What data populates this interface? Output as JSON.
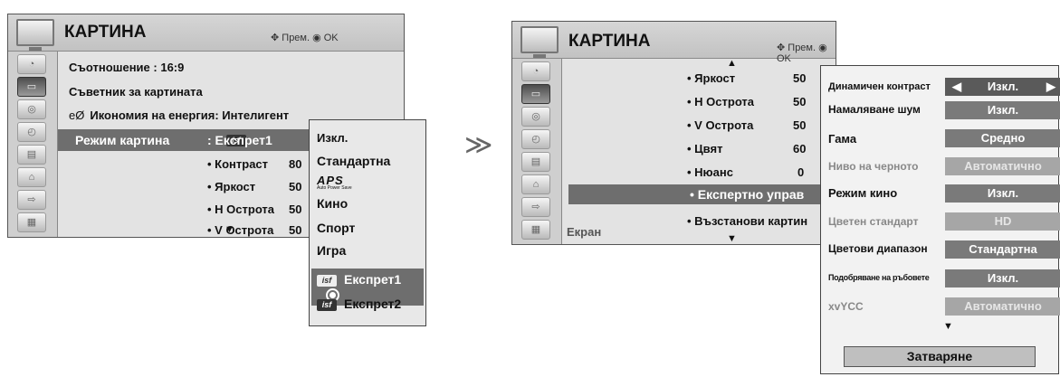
{
  "left_menu": {
    "title": "КАРТИНА",
    "hint": "Прем.  ◉  OK",
    "rows": [
      "Съотношение      : 16:9",
      "Съветник за картината",
      "Икономия на енергия: Интелигент"
    ],
    "eco_prefix": "eØ",
    "selected_row": {
      "label": "Режим картина",
      "value": ":   Експрет1"
    },
    "params": [
      {
        "label": "• Контраст",
        "value": "80"
      },
      {
        "label": "• Яркост",
        "value": "50"
      },
      {
        "label": "• Н Острота",
        "value": "50"
      },
      {
        "label": "• V Острота",
        "value": "50"
      }
    ]
  },
  "mode_dropdown": {
    "items": [
      "Изкл.",
      "Стандартна",
      "APS",
      "Кино",
      "Спорт",
      "Игра",
      "Експрет1",
      "Експрет2"
    ],
    "selected": "Експрет1",
    "isf_badge": "isf",
    "aps_subtext": "Auto Power Save"
  },
  "right_menu": {
    "title": "КАРТИНА",
    "hint": "Прем.  ◉  OK",
    "params": [
      {
        "label": "• Яркост",
        "value": "50"
      },
      {
        "label": "• Н Острота",
        "value": "50"
      },
      {
        "label": "• V Острота",
        "value": "50"
      },
      {
        "label": "• Цвят",
        "value": "60"
      },
      {
        "label": "• Нюанс",
        "value": "0"
      }
    ],
    "selected_row": "• Експертно управ",
    "reset_row": "• Възстанови картин",
    "footer_row": "Екран"
  },
  "expert_panel": {
    "rows": [
      {
        "label": "Динамичен контраст",
        "value": "Изкл."
      },
      {
        "label": "Намаляване шум",
        "value": "Изкл."
      },
      {
        "label": "Гама",
        "value": "Средно"
      },
      {
        "label": "Ниво на черното",
        "value": "Автоматично"
      },
      {
        "label": "Режим кино",
        "value": "Изкл."
      },
      {
        "label": "Цветен стандарт",
        "value": "HD"
      },
      {
        "label": "Цветови диапазон",
        "value": "Стандартна"
      },
      {
        "label": "Подобряване на ръбовете",
        "value": "Изкл."
      },
      {
        "label": "xvYCC",
        "value": "Автоматично"
      }
    ],
    "close_label": "Затваряне"
  },
  "icons": [
    "tv-icon",
    "satellite-icon",
    "picture-icon",
    "audio-icon",
    "time-icon",
    "option-icon",
    "lock-icon",
    "input-icon",
    "usb-icon"
  ]
}
